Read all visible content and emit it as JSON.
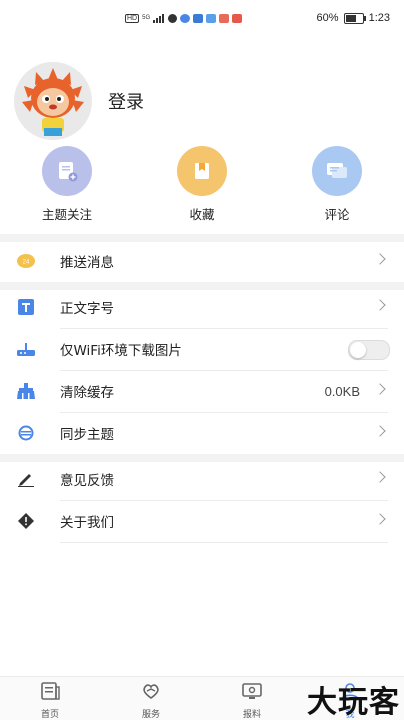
{
  "status_bar": {
    "left_badge": "HD",
    "signal": "5G",
    "battery": "60%",
    "battery_level": 0.6,
    "time": "1:23"
  },
  "profile": {
    "login_label": "登录"
  },
  "quick_actions": [
    {
      "label": "主题关注",
      "icon": "topic-follow-icon",
      "color": "#b9c0ea"
    },
    {
      "label": "收藏",
      "icon": "favorites-icon",
      "color": "#f4c56c"
    },
    {
      "label": "评论",
      "icon": "comment-icon",
      "color": "#a9c9f2"
    }
  ],
  "settings": {
    "push": {
      "label": "推送消息",
      "icon": "push-badge-icon",
      "badge": "24"
    },
    "font_size": {
      "label": "正文字号",
      "icon": "text-size-icon"
    },
    "wifi_images": {
      "label": "仅WiFi环境下载图片",
      "icon": "router-icon",
      "enabled": false
    },
    "clear_cache": {
      "label": "清除缓存",
      "icon": "broom-icon",
      "value": "0.0KB"
    },
    "sync_topics": {
      "label": "同步主题",
      "icon": "sync-icon"
    },
    "feedback": {
      "label": "意见反馈",
      "icon": "pencil-icon"
    },
    "about": {
      "label": "关于我们",
      "icon": "info-diamond-icon"
    }
  },
  "bottom_nav": [
    {
      "label": "首页",
      "icon": "home-icon"
    },
    {
      "label": "服务",
      "icon": "service-icon"
    },
    {
      "label": "报料",
      "icon": "report-icon"
    },
    {
      "label": "我",
      "icon": "me-icon",
      "active": true
    }
  ],
  "watermark": "大玩客",
  "colors": {
    "accent": "#4a86e8",
    "band": "#f2f2f2"
  }
}
